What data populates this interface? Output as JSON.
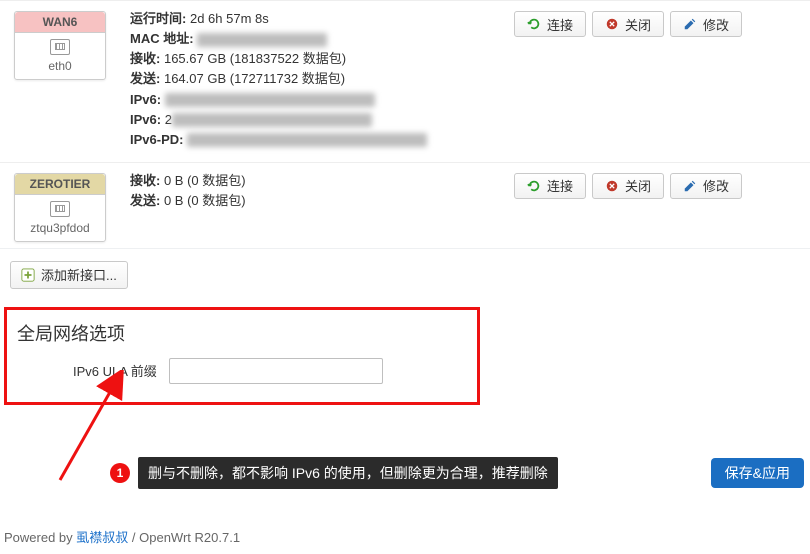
{
  "interfaces": [
    {
      "name": "WAN6",
      "device": "eth0",
      "head_color": "pink",
      "info": {
        "uptime_label": "运行时间:",
        "uptime_value": "2d 6h 57m 8s",
        "mac_label": "MAC 地址:",
        "rx_label": "接收:",
        "rx_value": "165.67 GB (181837522 数据包)",
        "tx_label": "发送:",
        "tx_value": "164.07 GB (172711732 数据包)",
        "ipv6_label_a": "IPv6:",
        "ipv6_label_b": "IPv6:",
        "ipv6pd_label": "IPv6-PD:"
      }
    },
    {
      "name": "ZEROTIER",
      "device": "ztqu3pfdod",
      "head_color": "tan",
      "info": {
        "rx_label": "接收:",
        "rx_value": "0 B (0 数据包)",
        "tx_label": "发送:",
        "tx_value": "0 B (0 数据包)"
      }
    }
  ],
  "action_labels": {
    "connect": "连接",
    "shutdown": "关闭",
    "edit": "修改"
  },
  "add_interface_label": "添加新接口...",
  "panel": {
    "title": "全局网络选项",
    "ula_label": "IPv6 ULA 前缀",
    "ula_value": ""
  },
  "callout": {
    "num": "1",
    "text": "删与不删除，都不影响 IPv6 的使用，但删除更为合理，推荐删除"
  },
  "save_apply_label": "保存&应用",
  "footer": {
    "powered": "Powered by ",
    "author": "虱襟叔叔",
    "sep": " / ",
    "version": "OpenWrt R20.7.1"
  }
}
